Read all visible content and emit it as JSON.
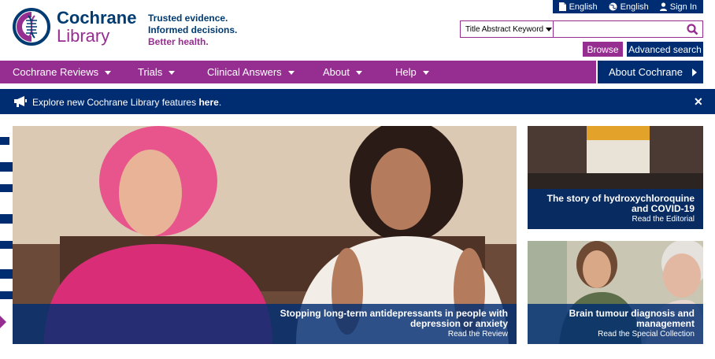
{
  "utility": {
    "lang1": "English",
    "lang2": "English",
    "signin": "Sign In"
  },
  "brand": {
    "line1": "Cochrane",
    "line2": "Library",
    "tagline1": "Trusted evidence.",
    "tagline2": "Informed decisions.",
    "tagline3": "Better health."
  },
  "search": {
    "scope": "Title Abstract Keyword",
    "placeholder": "",
    "value": "",
    "browse_label": "Browse",
    "advanced_label": "Advanced search"
  },
  "nav": {
    "items": [
      {
        "label": "Cochrane Reviews"
      },
      {
        "label": "Trials"
      },
      {
        "label": "Clinical Answers"
      },
      {
        "label": "About"
      },
      {
        "label": "Help"
      }
    ],
    "about_cochrane": "About Cochrane"
  },
  "announcement": {
    "text": "Explore new Cochrane Library features ",
    "link": "here",
    "end": "."
  },
  "hero": {
    "title_line1": "Stopping long-term antidepressants in people with",
    "title_line2": "depression or anxiety",
    "sub": "Read the Review"
  },
  "side_cards": [
    {
      "title_line1": "The story of hydroxychloroquine",
      "title_line2": "and COVID-19",
      "sub": "Read the Editorial"
    },
    {
      "title_line1": "Brain tumour diagnosis and",
      "title_line2": "management",
      "sub": "Read the Special Collection"
    }
  ],
  "colors": {
    "navy": "#002d72",
    "purple": "#962d91",
    "brand_text": "#003b71"
  }
}
